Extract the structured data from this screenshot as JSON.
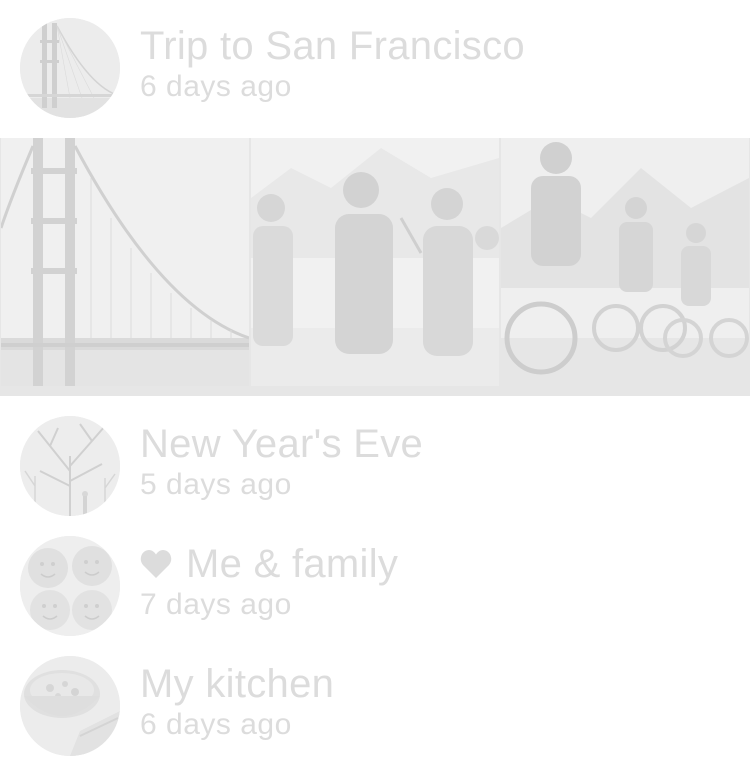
{
  "albums": [
    {
      "title": "Trip to San Francisco",
      "date": "6 days ago",
      "favorite": false,
      "thumbnail": "golden-gate-bridge"
    },
    {
      "title": "New Year's Eve",
      "date": "5 days ago",
      "favorite": false,
      "thumbnail": "snowy-trees"
    },
    {
      "title": "Me & family",
      "date": "7 days ago",
      "favorite": true,
      "thumbnail": "family-faces"
    },
    {
      "title": "My kitchen",
      "date": "6 days ago",
      "favorite": false,
      "thumbnail": "soup-bowl"
    }
  ],
  "expanded_album_photos": [
    {
      "subject": "golden-gate-bridge"
    },
    {
      "subject": "family-hiking"
    },
    {
      "subject": "mountain-biking"
    }
  ],
  "icons": {
    "favorite": "heart-icon"
  },
  "colors": {
    "text": "#dcdcdc",
    "background": "#ffffff",
    "strip_background": "#e6e6e6"
  }
}
